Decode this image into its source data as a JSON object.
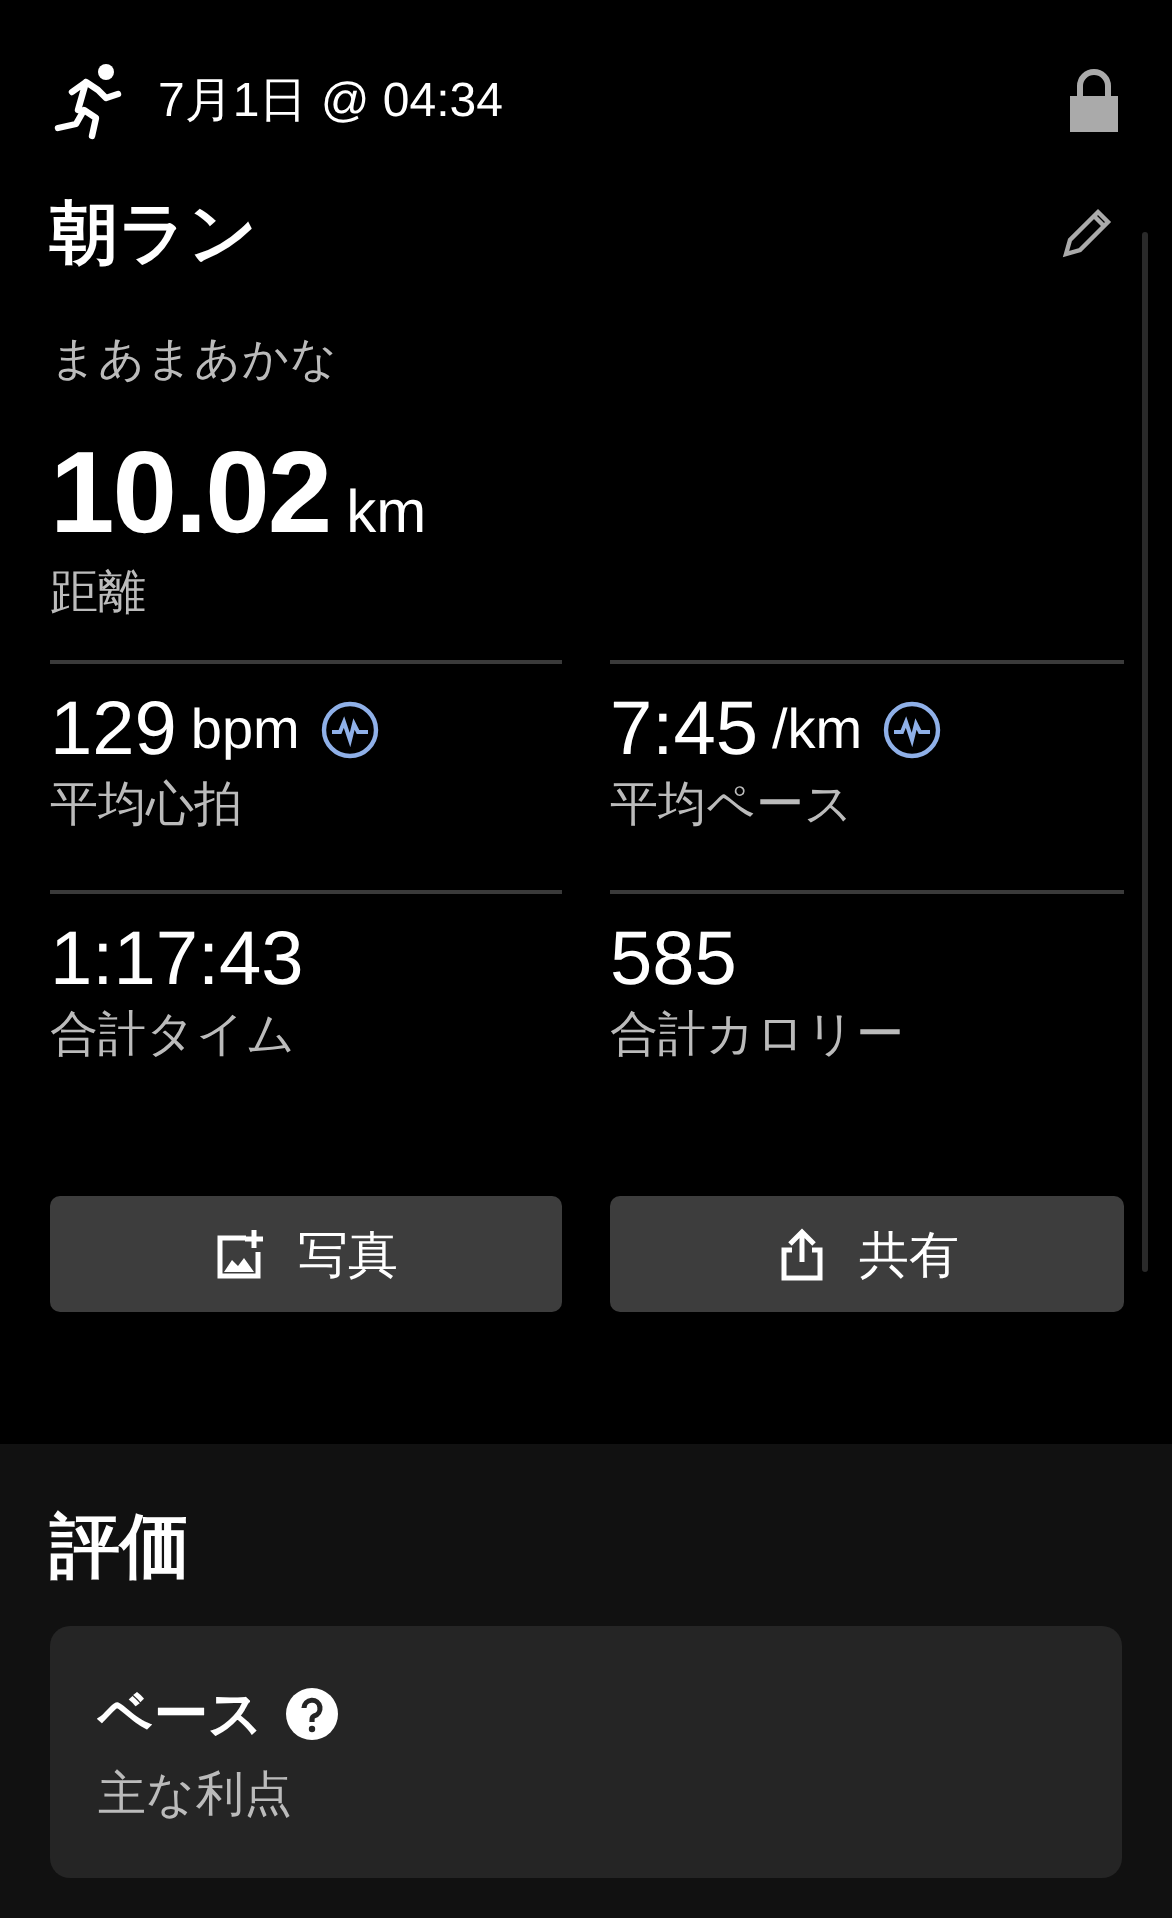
{
  "header": {
    "date": "7月1日 @ 04:34",
    "locked": true
  },
  "activity": {
    "title": "朝ラン",
    "description": "まあまあかな",
    "distance": {
      "value": "10.02",
      "unit": "km",
      "label": "距離"
    }
  },
  "stats": [
    {
      "value": "129",
      "unit": "bpm",
      "label": "平均心拍",
      "chart_link": true
    },
    {
      "value": "7:45",
      "unit": "/km",
      "label": "平均ペース",
      "chart_link": true
    },
    {
      "value": "1:17:43",
      "label": "合計タイム",
      "chart_link": false
    },
    {
      "value": "585",
      "label": "合計カロリー",
      "chart_link": false
    }
  ],
  "buttons": [
    {
      "kind": "photo",
      "label": "写真"
    },
    {
      "kind": "share",
      "label": "共有"
    }
  ],
  "evaluation": {
    "title": "評価",
    "card": {
      "title": "ベース",
      "subtitle": "主な利点"
    }
  }
}
